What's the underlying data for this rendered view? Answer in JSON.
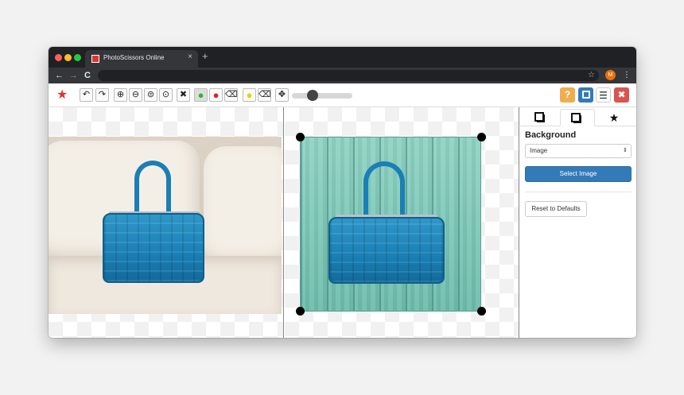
{
  "browser": {
    "tab_title": "PhotoScissors Online",
    "tab_close": "×",
    "new_tab": "+",
    "back": "←",
    "forward": "→",
    "reload": "C",
    "bookmark": "☆",
    "profile_initial": "M",
    "menu": "⋮"
  },
  "toolbar": {
    "undo": "↶",
    "redo": "↷",
    "zoom_in": "⊕",
    "zoom_out": "⊖",
    "zoom_actual": "⊜",
    "zoom_fit": "⊙",
    "clear": "✖",
    "keep_marker": "●",
    "remove_marker": "●",
    "eraser": "⌫",
    "hair_marker": "●",
    "hair_eraser": "⌫",
    "move": "✥",
    "brush_size_fraction": 0.3,
    "help": "?",
    "save": "💾",
    "menu": "☰",
    "close": "✖",
    "colors": {
      "help": "#f0ad4e",
      "save": "#337ab7",
      "close": "#d9534f",
      "keep": "#2eb82e",
      "remove": "#dd2222",
      "hair": "#f5e100"
    }
  },
  "panel": {
    "tabs": [
      {
        "icon": "layers-front-icon"
      },
      {
        "icon": "layers-back-icon"
      },
      {
        "icon": "star-icon",
        "glyph": "★"
      }
    ],
    "heading": "Background",
    "background_type": "Image",
    "select_arrow": "⇕",
    "select_image_label": "Select Image",
    "reset_label": "Reset to Defaults",
    "accent": "#337ab7"
  }
}
